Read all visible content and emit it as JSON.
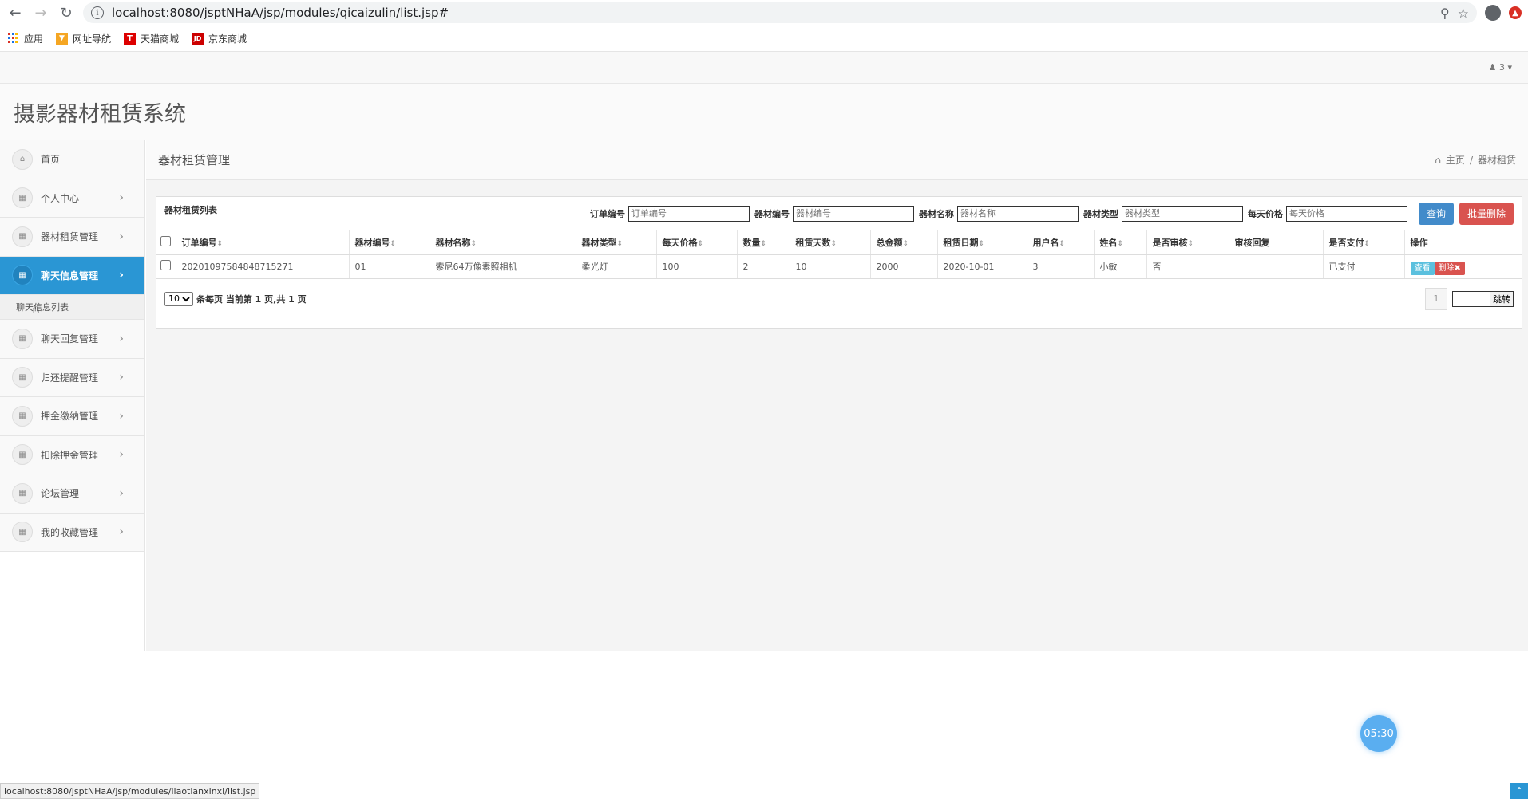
{
  "browser": {
    "url": "localhost:8080/jsptNHaA/jsp/modules/qicaizulin/list.jsp#",
    "bookmarks": [
      "应用",
      "网址导航",
      "天猫商城",
      "京东商城"
    ],
    "status_url": "localhost:8080/jsptNHaA/jsp/modules/liaotianxinxi/list.jsp"
  },
  "topbar": {
    "user": "3"
  },
  "app": {
    "title": "摄影器材租赁系统"
  },
  "sidebar": {
    "items": [
      {
        "label": "首页"
      },
      {
        "label": "个人中心"
      },
      {
        "label": "器材租赁管理"
      },
      {
        "label": "聊天信息管理"
      },
      {
        "label": "聊天回复管理"
      },
      {
        "label": "归还提醒管理"
      },
      {
        "label": "押金缴纳管理"
      },
      {
        "label": "扣除押金管理"
      },
      {
        "label": "论坛管理"
      },
      {
        "label": "我的收藏管理"
      }
    ],
    "active_index": 3,
    "sub_item": "聊天信息列表"
  },
  "page": {
    "title": "器材租赁管理",
    "breadcrumb": {
      "home": "主页",
      "current": "器材租赁"
    }
  },
  "panel": {
    "title": "器材租赁列表"
  },
  "search": {
    "fields": [
      {
        "label": "订单编号",
        "placeholder": "订单编号"
      },
      {
        "label": "器材编号",
        "placeholder": "器材编号"
      },
      {
        "label": "器材名称",
        "placeholder": "器材名称"
      },
      {
        "label": "器材类型",
        "placeholder": "器材类型"
      },
      {
        "label": "每天价格",
        "placeholder": "每天价格"
      }
    ],
    "query_label": "查询",
    "batch_delete_label": "批量删除"
  },
  "table": {
    "headers": [
      "订单编号",
      "器材编号",
      "器材名称",
      "器材类型",
      "每天价格",
      "数量",
      "租赁天数",
      "总金额",
      "租赁日期",
      "用户名",
      "姓名",
      "是否审核",
      "审核回复",
      "是否支付",
      "操作"
    ],
    "rows": [
      {
        "order_no": "20201097584848715271",
        "equip_no": "01",
        "equip_name": "索尼64万像素照相机",
        "equip_type": "柔光灯",
        "daily_price": "100",
        "quantity": "2",
        "days": "10",
        "total": "2000",
        "date": "2020-10-01",
        "username": "3",
        "name": "小敏",
        "reviewed": "否",
        "review_reply": "",
        "paid": "已支付",
        "view_label": "查看",
        "delete_label": "删除"
      }
    ]
  },
  "pager": {
    "page_size": "10",
    "info": "条每页 当前第 1 页,共 1 页",
    "current_page": "1",
    "jump_label": "跳转"
  },
  "widget": {
    "clock": "05:30"
  },
  "colors": {
    "primary": "#2a96d4",
    "danger": "#d9534f",
    "info": "#5bc0de",
    "query": "#428bca"
  }
}
